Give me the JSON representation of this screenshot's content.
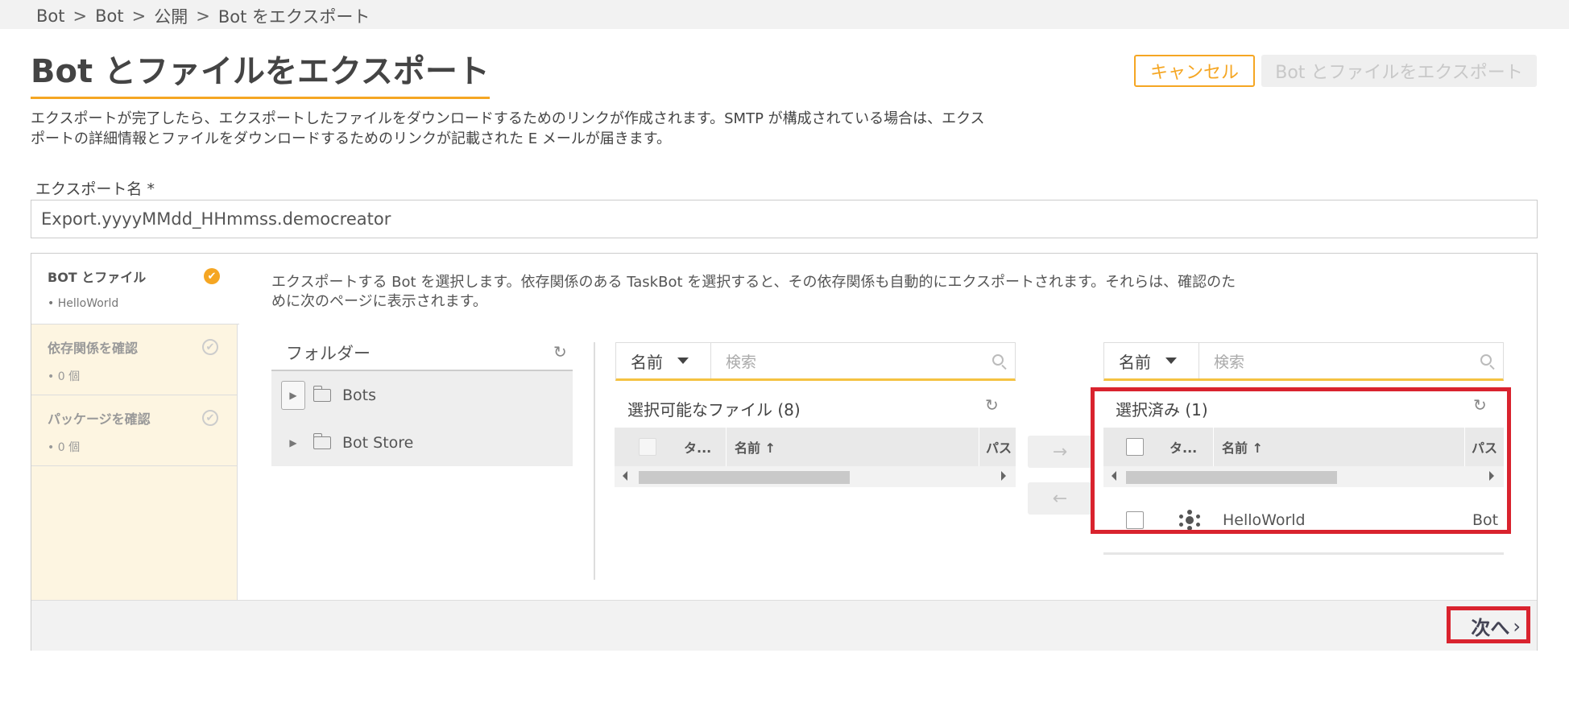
{
  "breadcrumb": [
    "Bot",
    "Bot",
    "公開",
    "Bot をエクスポート"
  ],
  "header": {
    "title": "Bot とファイルをエクスポート",
    "cancel_label": "キャンセル",
    "export_label": "Bot とファイルをエクスポート"
  },
  "description_line1": "エクスポートが完了したら、エクスポートしたファイルをダウンロードするためのリンクが作成されます。SMTP が構成されている場合は、エクス",
  "description_line2": "ポートの詳細情報とファイルをダウンロードするためのリンクが記載された E メールが届きます。",
  "export_name": {
    "label": "エクスポート名 *",
    "value": "Export.yyyyMMdd_HHmmss.democreator"
  },
  "steps": [
    {
      "title": "BOT とファイル",
      "sub": "• HelloWorld",
      "status": "done"
    },
    {
      "title": "依存関係を確認",
      "sub": "• 0 個",
      "status": "todo"
    },
    {
      "title": "パッケージを確認",
      "sub": "• 0 個",
      "status": "todo"
    }
  ],
  "content_desc_line1": "エクスポートする Bot を選択します。依存関係のある TaskBot を選択すると、その依存関係も自動的にエクスポートされます。それらは、確認のた",
  "content_desc_line2": "めに次のページに表示されます。",
  "folders": {
    "title": "フォルダー",
    "items": [
      "Bots",
      "Bot Store"
    ]
  },
  "available": {
    "search_field": "名前",
    "search_placeholder": "検索",
    "title": "選択可能なファイル (8)",
    "columns": [
      "タ...",
      "名前 ↑",
      "パス"
    ]
  },
  "selected": {
    "search_field": "名前",
    "search_placeholder": "検索",
    "title": "選択済み (1)",
    "columns": [
      "タ...",
      "名前 ↑",
      "パス"
    ],
    "rows": [
      {
        "name": "HelloWorld",
        "path": "Bot"
      }
    ]
  },
  "move_right": "→",
  "move_left": "←",
  "next_label": "次へ",
  "icons": {
    "refresh": "↻",
    "chevron": "›",
    "check": "✔"
  },
  "colors": {
    "accent": "#f5a623",
    "highlight": "#d9232e"
  }
}
